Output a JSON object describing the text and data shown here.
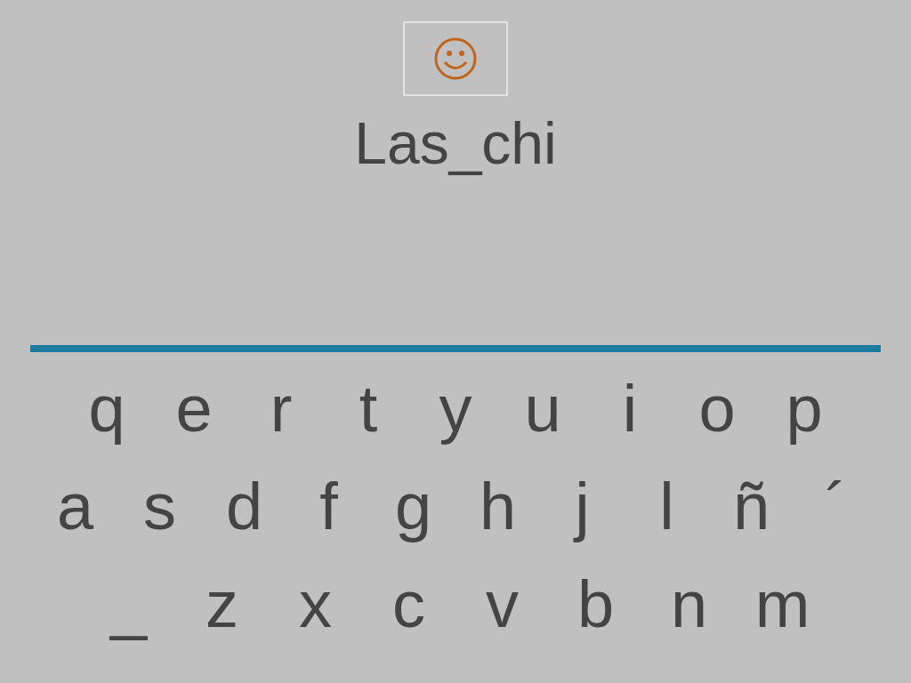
{
  "word": "Las_chi",
  "keyboard": {
    "rows": [
      [
        "q",
        "e",
        "r",
        "t",
        "y",
        "u",
        "i",
        "o",
        "p"
      ],
      [
        "a",
        "s",
        "d",
        "f",
        "g",
        "h",
        "j",
        "l",
        "ñ",
        "´"
      ],
      [
        "_",
        "z",
        "x",
        "c",
        "v",
        "b",
        "n",
        "m"
      ]
    ]
  }
}
